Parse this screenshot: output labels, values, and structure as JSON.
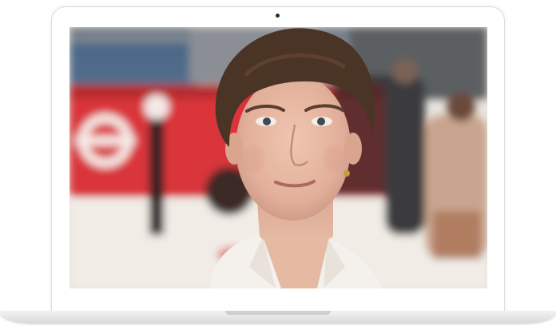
{
  "image": {
    "subject": "portrait-photo",
    "colors": {
      "bus_red": "#d9363a",
      "background_light": "#ece7e0",
      "hair": "#4a3426",
      "skin": "#e6b9a2",
      "shirt": "#f4f1ec"
    }
  },
  "device": {
    "type": "laptop-mockup",
    "bezel_color": "#ffffff",
    "base_color": "#e2e2e2"
  }
}
